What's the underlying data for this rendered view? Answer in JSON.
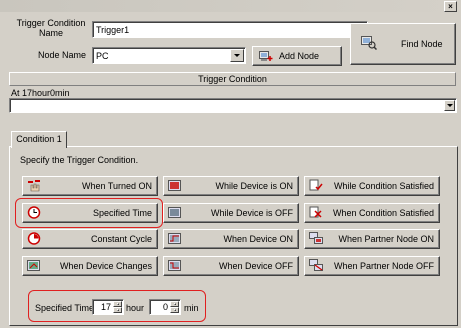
{
  "form": {
    "trigger_name_label": "Trigger Condition Name",
    "trigger_name_value": "Trigger1",
    "node_name_label": "Node Name",
    "node_name_value": "PC",
    "add_node_label": "Add Node",
    "find_node_label": "Find Node"
  },
  "trigger_condition": {
    "header": "Trigger Condition",
    "summary": "At 17hour0min",
    "combo_value": ""
  },
  "tabs": [
    {
      "label": "Condition 1",
      "selected": true
    }
  ],
  "panel": {
    "instruction": "Specify the Trigger Condition."
  },
  "conditions": {
    "col1": [
      "When Turned ON",
      "Specified Time",
      "Constant Cycle",
      "When Device Changes"
    ],
    "col2": [
      "While Device is ON",
      "While Device is OFF",
      "When Device ON",
      "When Device OFF"
    ],
    "col3": [
      "While Condition Satisfied",
      "When Condition Satisfied",
      "When Partner Node ON",
      "When Partner Node OFF"
    ],
    "selected": "Specified Time"
  },
  "specified_time": {
    "label": "Specified Time",
    "hour_value": "17",
    "hour_unit": "hour",
    "min_value": "0",
    "min_unit": "min"
  },
  "colors": {
    "window_bg": "#d4d0c8",
    "highlight": "#e02020"
  }
}
